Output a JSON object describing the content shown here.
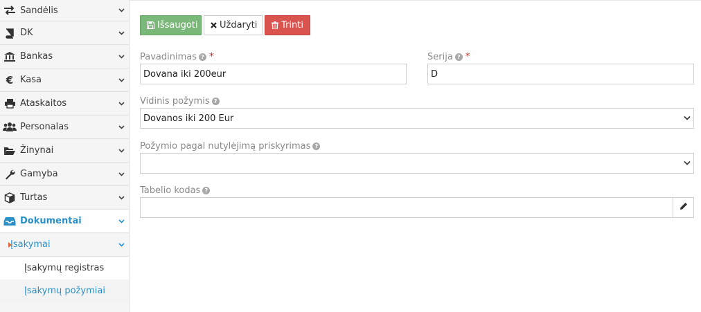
{
  "sidebar": {
    "items": [
      {
        "label": "Sandėlis",
        "icon": "exchange-icon"
      },
      {
        "label": "DK",
        "icon": "book-icon"
      },
      {
        "label": "Bankas",
        "icon": "bank-icon"
      },
      {
        "label": "Kasa",
        "icon": "euro-icon"
      },
      {
        "label": "Ataskaitos",
        "icon": "print-icon"
      },
      {
        "label": "Personalas",
        "icon": "users-icon"
      },
      {
        "label": "Žinynai",
        "icon": "folder-open-icon"
      },
      {
        "label": "Gamyba",
        "icon": "wrench-icon"
      },
      {
        "label": "Turtas",
        "icon": "cube-icon"
      },
      {
        "label": "Dokumentai",
        "icon": "inbox-icon"
      }
    ],
    "submenu": {
      "label": "Įsakymai"
    },
    "subsub": [
      {
        "label": "Įsakymų registras"
      },
      {
        "label": "Įsakymų požymiai"
      }
    ]
  },
  "toolbar": {
    "save_label": "Išsaugoti",
    "close_label": "Uždaryti",
    "delete_label": "Trinti"
  },
  "form": {
    "pavadinimas": {
      "label": "Pavadinimas",
      "value": "Dovana iki 200eur"
    },
    "serija": {
      "label": "Serija",
      "value": "D"
    },
    "vidinis": {
      "label": "Vidinis požymis",
      "value": "Dovanos iki 200 Eur"
    },
    "pozymio": {
      "label": "Požymio pagal nutylėjimą priskyrimas",
      "value": ""
    },
    "tabelio": {
      "label": "Tabelio kodas",
      "value": ""
    }
  },
  "colors": {
    "accent": "#2b8fc7",
    "save": "#7ab87a",
    "delete": "#d9534f",
    "required": "#d0342c"
  }
}
